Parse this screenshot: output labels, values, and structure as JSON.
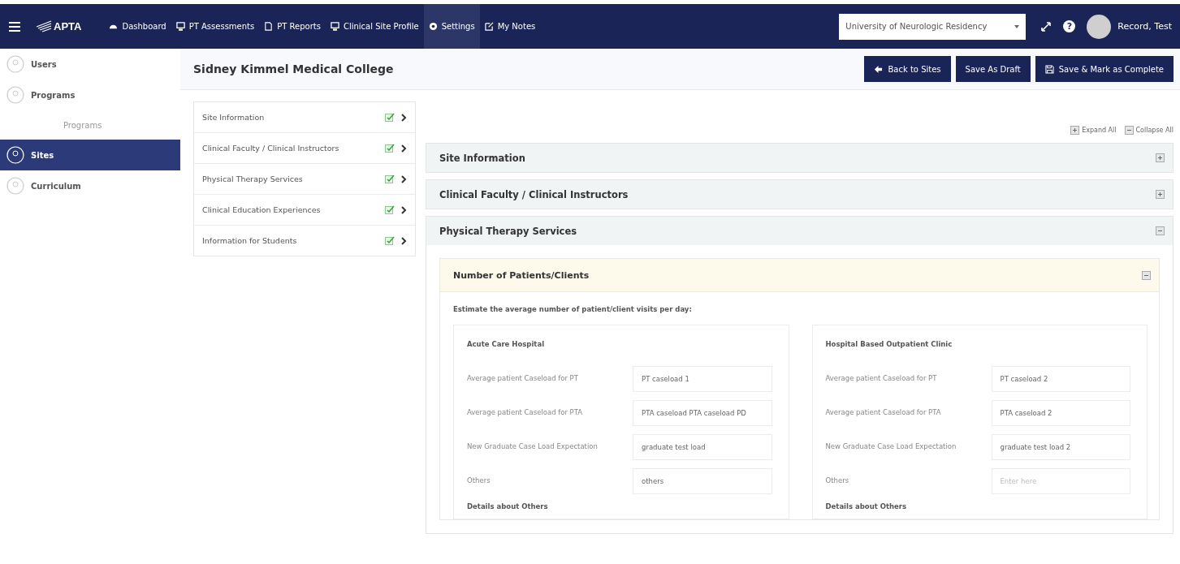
{
  "topbar": {
    "brand": "APTA",
    "nav": [
      {
        "label": "Dashboard",
        "selected": false
      },
      {
        "label": "PT Assessments",
        "selected": false
      },
      {
        "label": "PT Reports",
        "selected": false
      },
      {
        "label": "Clinical Site Profile",
        "selected": false
      },
      {
        "label": "Settings",
        "selected": true
      },
      {
        "label": "My Notes",
        "selected": false
      }
    ],
    "program_select": "University of Neurologic Residency",
    "help": "?",
    "user": "Record, Test"
  },
  "sidebar": {
    "items": [
      {
        "label": "Users",
        "selected": false
      },
      {
        "label": "Programs",
        "selected": false,
        "children": [
          {
            "label": "Programs",
            "selected": false
          }
        ]
      },
      {
        "label": "Sites",
        "selected": true
      },
      {
        "label": "Curriculum",
        "selected": false
      }
    ]
  },
  "header": {
    "title": "Sidney Kimmel Medical College",
    "buttons": [
      "Back to Sites",
      "Save As Draft",
      "Save & Mark as Complete"
    ]
  },
  "section_nav": [
    {
      "label": "Site Information",
      "done": true
    },
    {
      "label": "Clinical Faculty / Clinical Instructors",
      "done": true
    },
    {
      "label": "Physical Therapy Services",
      "done": true
    },
    {
      "label": "Clinical Education Experiences",
      "done": true
    },
    {
      "label": "Information for Students",
      "done": true
    }
  ],
  "toggles": [
    "Expand All",
    "Collapse All"
  ],
  "sections": [
    {
      "title": "Site Information",
      "expanded": false
    },
    {
      "title": "Clinical Faculty / Clinical Instructors",
      "expanded": false
    },
    {
      "title": "Physical Therapy Services",
      "expanded": true,
      "panel": {
        "title": "Number of Patients/Clients",
        "expanded": true,
        "prompt": "Estimate the average number of patient/client visits per day:",
        "cards": [
          {
            "title": "Acute Care Hospital",
            "fields": [
              {
                "label": "Average patient Caseload for PT",
                "value": "PT caseload 1"
              },
              {
                "label": "Average patient Caseload for PTA",
                "value": "PTA caseload PTA caseload PD"
              },
              {
                "label": "New Graduate Case Load Expectation",
                "value": "graduate test load"
              },
              {
                "label": "Others",
                "value": "others"
              }
            ],
            "footer": "Details about Others"
          },
          {
            "title": "Hospital Based Outpatient Clinic",
            "fields": [
              {
                "label": "Average patient Caseload for PT",
                "value": "PT caseload 2"
              },
              {
                "label": "Average patient Caseload for PTA",
                "value": "PTA caseload 2"
              },
              {
                "label": "New Graduate Case Load Expectation",
                "value": "graduate test load 2"
              },
              {
                "label": "Others",
                "placeholder": "Enter here"
              }
            ],
            "footer": "Details about Others"
          }
        ]
      }
    }
  ]
}
